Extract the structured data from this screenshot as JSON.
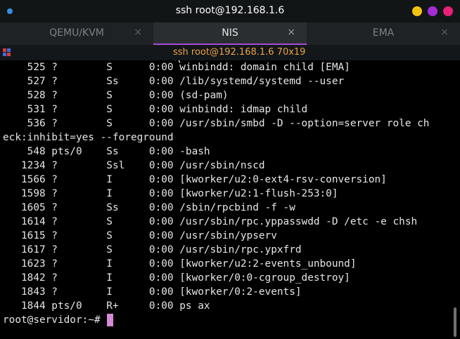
{
  "window": {
    "title": "ssh root@192.168.1.6"
  },
  "tabs": [
    {
      "label": "QEMU/KVM",
      "close": "×",
      "active": false
    },
    {
      "label": "NIS",
      "close": "×",
      "active": true
    },
    {
      "label": "EMA",
      "close": "×",
      "active": false
    }
  ],
  "session": {
    "title": "ssh root@192.168.1.6 70x19"
  },
  "terminal": {
    "lines": [
      "    525 ?        S      0:00 winbindd: domain child [EMA]",
      "    527 ?        Ss     0:00 /lib/systemd/systemd --user",
      "    528 ?        S      0:00 (sd-pam)",
      "    531 ?        S      0:00 winbindd: idmap child",
      "    536 ?        S      0:00 /usr/sbin/smbd -D --option=server role ch",
      "eck:inhibit=yes --foreground",
      "    548 pts/0    Ss     0:00 -bash",
      "   1234 ?        Ssl    0:00 /usr/sbin/nscd",
      "   1566 ?        I      0:00 [kworker/u2:0-ext4-rsv-conversion]",
      "   1598 ?        I      0:00 [kworker/u2:1-flush-253:0]",
      "   1605 ?        Ss     0:00 /sbin/rpcbind -f -w",
      "   1614 ?        S      0:00 /usr/sbin/rpc.yppasswdd -D /etc -e chsh",
      "   1615 ?        S      0:00 /usr/sbin/ypserv",
      "   1617 ?        S      0:00 /usr/sbin/rpc.ypxfrd",
      "   1623 ?        I      0:00 [kworker/u2:2-events_unbound]",
      "   1842 ?        I      0:00 [kworker/0:0-cgroup_destroy]",
      "   1843 ?        I      0:00 [kworker/0:2-events]",
      "   1844 pts/0    R+     0:00 ps ax"
    ],
    "prompt": "root@servidor:~# "
  },
  "colors": {
    "accent": "#a64bd6",
    "cursor": "#d78ad7",
    "session_title": "#e8a24a",
    "minimize": "#f1c40f",
    "maximize": "#a52bd6",
    "close": "#e8207a"
  },
  "icons": {
    "window_menu": "dot-icon",
    "tab_close": "close-icon",
    "session": "split-view-icon",
    "pointer": "mouse-pointer-icon"
  }
}
